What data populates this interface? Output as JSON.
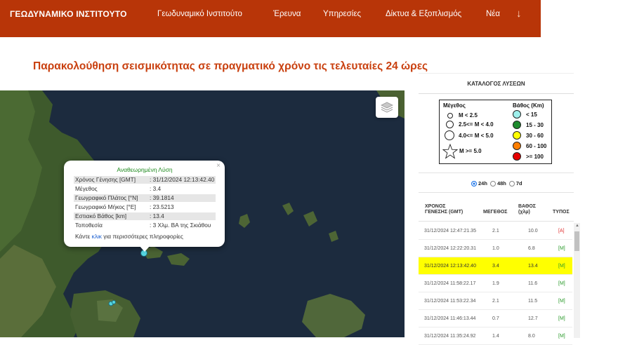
{
  "header": {
    "brand": "ΓΕΩΔΥΝΑΜΙΚΟ ΙΝΣΤΙΤΟΥΤΟ",
    "nav": [
      "Γεωδυναμικό Ινστιτούτο",
      "Έρευνα",
      "Υπηρεσίες",
      "Δίκτυα & Εξοπλισμός",
      "Νέα"
    ],
    "more_icon": "arrow-down-icon"
  },
  "page_title": "Παρακολούθηση σεισμικότητας σε πραγματικό χρόνο τις τελευταίες 24 ώρες",
  "map": {
    "layer_icon": "layers-icon",
    "popup": {
      "heading": "Αναθεωρημένη Λύση",
      "rows": [
        {
          "k": "Χρόνος Γένησης [GMT]",
          "v": ": 31/12/2024 12:13:42.40"
        },
        {
          "k": "Μέγεθος",
          "v": ": 3.4"
        },
        {
          "k": "Γεωγραφικό Πλάτος [°N]",
          "v": ": 39.1814"
        },
        {
          "k": "Γεωγραφικό Μήκος [°E]",
          "v": ": 23.5213"
        },
        {
          "k": "Εστιακό Βάθος [km]",
          "v": ": 13.4"
        },
        {
          "k": "Τοποθεσία",
          "v": ": 3 Χλμ. ΒΑ της Σκιάθου"
        }
      ],
      "footer_pre": "Κάντε",
      "footer_link": "κλικ",
      "footer_post": "για περισσότερες πληροφορίες",
      "close": "×"
    }
  },
  "panel": {
    "title": "ΚΑΤΑΛΟΓΟΣ ΛΥΣΕΩΝ",
    "legend": {
      "mag_title": "Μέγεθος",
      "mag_items": [
        "M < 2.5",
        "2.5<= M < 4.0",
        "4.0<= M < 5.0",
        "M >= 5.0"
      ],
      "depth_title": "Βάθος (Km)",
      "depth_items": [
        {
          "label": "< 15",
          "color": "#9ff0ec"
        },
        {
          "label": "15 - 30",
          "color": "#1e8b2e"
        },
        {
          "label": "30 - 60",
          "color": "#ffff00"
        },
        {
          "label": "60 - 100",
          "color": "#ff7f00"
        },
        {
          "label": ">= 100",
          "color": "#e60000"
        }
      ]
    },
    "ranges": [
      "24h",
      "48h",
      "7d"
    ],
    "table": {
      "headers": {
        "time1": "ΧΡΟΝΟΣ",
        "time2": "ΓΕΝΕΣΗΣ (GMT)",
        "mag": "ΜΕΓΕΘΟΣ",
        "depth1": "ΒΑΘΟΣ",
        "depth2": "(χλμ)",
        "type": "ΤΥΠΟΣ"
      },
      "rows": [
        {
          "time": "31/12/2024 12:47:21.35",
          "mag": "2.1",
          "depth": "10.0",
          "type": "[A]",
          "type_color": "#e03030"
        },
        {
          "time": "31/12/2024 12:22:20.31",
          "mag": "1.0",
          "depth": "6.8",
          "type": "[M]",
          "type_color": "#2a9a2a"
        },
        {
          "time": "31/12/2024 12:13:42.40",
          "mag": "3.4",
          "depth": "13.4",
          "type": "[M]",
          "type_color": "#2a9a2a"
        },
        {
          "time": "31/12/2024 11:58:22.17",
          "mag": "1.9",
          "depth": "11.6",
          "type": "[M]",
          "type_color": "#2a9a2a"
        },
        {
          "time": "31/12/2024 11:53:22.34",
          "mag": "2.1",
          "depth": "11.5",
          "type": "[M]",
          "type_color": "#2a9a2a"
        },
        {
          "time": "31/12/2024 11:46:13.44",
          "mag": "0.7",
          "depth": "12.7",
          "type": "[M]",
          "type_color": "#2a9a2a"
        },
        {
          "time": "31/12/2024 11:35:24.92",
          "mag": "1.4",
          "depth": "8.0",
          "type": "[M]",
          "type_color": "#2a9a2a"
        }
      ],
      "highlight_row": 2
    }
  }
}
